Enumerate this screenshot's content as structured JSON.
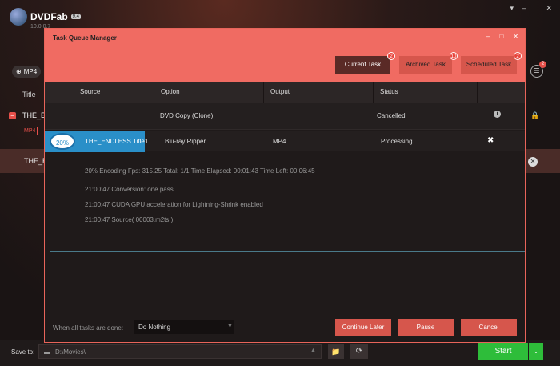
{
  "app": {
    "logo_text": "DVDFab",
    "logo_version": "9.4",
    "logo_sub": "10.0.0.7"
  },
  "main": {
    "profile_button": "MP4",
    "title_column": "Title",
    "rows": [
      {
        "title": "THE_E",
        "tag": "MP4"
      },
      {
        "title": "THE_E"
      }
    ],
    "list_badge": "2"
  },
  "bottom": {
    "save_to_label": "Save to:",
    "path": "D:\\Movies\\",
    "start_label": "Start"
  },
  "dialog": {
    "title": "Task Queue Manager",
    "tabs": [
      {
        "label": "Current Task",
        "badge": "2"
      },
      {
        "label": "Archived Task",
        "badge": "10"
      },
      {
        "label": "Scheduled Task",
        "badge": "2"
      }
    ],
    "columns": [
      "Source",
      "Option",
      "Output",
      "Status"
    ],
    "tasks": [
      {
        "source": "",
        "option": "DVD Copy (Clone)",
        "output": "",
        "status": "Cancelled"
      },
      {
        "progress": "20%",
        "source": "THE_ENDLESS.Title1",
        "option": "Blu-ray Ripper",
        "output": "MP4",
        "status": "Processing"
      }
    ],
    "log": [
      "20%  Encoding Fps: 315.25   Total: 1/1   Time Elapsed: 00:01:43   Time Left: 00:06:45",
      "21:00:47    Conversion: one pass",
      "21:00:47    CUDA GPU acceleration for Lightning-Shrink enabled",
      "21:00:47    Source( 00003.m2ts )"
    ],
    "when_done_label": "When all tasks are done:",
    "when_done_value": "Do Nothing",
    "buttons": {
      "continue_later": "Continue Later",
      "pause": "Pause",
      "cancel": "Cancel"
    }
  },
  "colors": {
    "accent": "#f06b62",
    "button": "#d6564c",
    "progress": "#2a8fc8",
    "start": "#2ebd3a"
  }
}
